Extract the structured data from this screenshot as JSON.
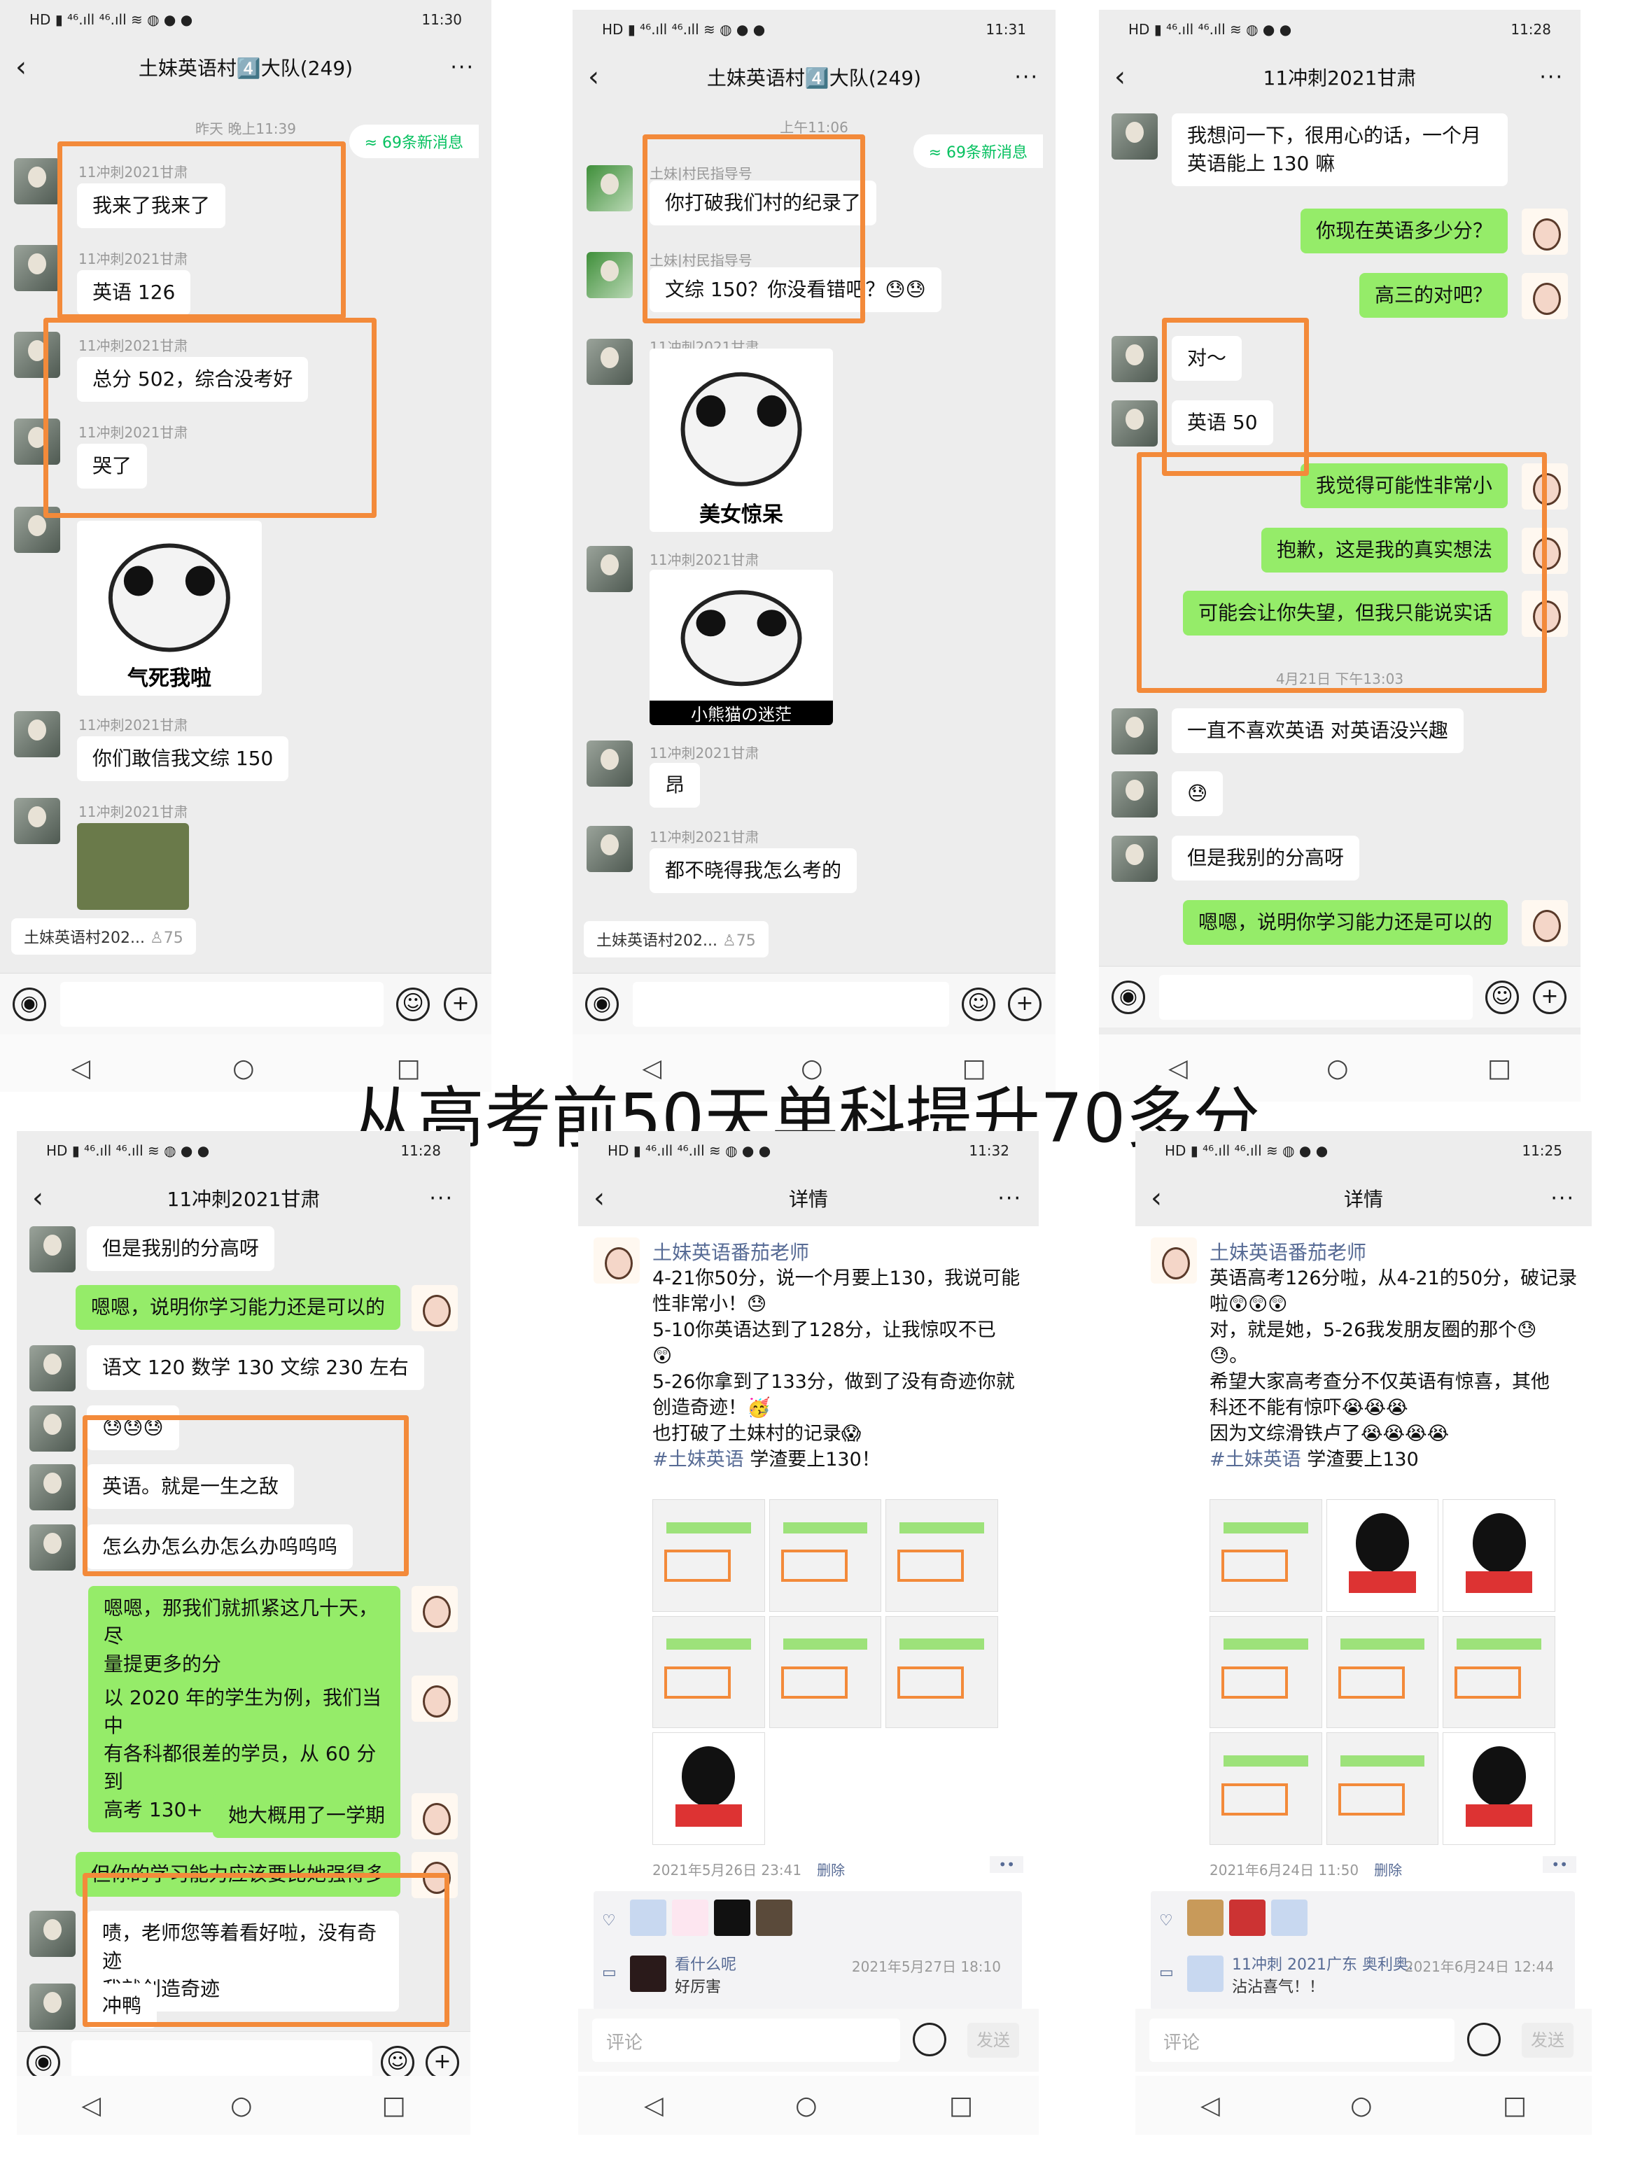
{
  "headline": "从高考前50天单科提升70多分",
  "status": {
    "p1": "11:30",
    "p2": "11:31",
    "p3": "11:28",
    "p4": "11:28",
    "p5": "11:32",
    "p6": "11:25"
  },
  "icons": {
    "back": "‹",
    "more": "···",
    "home": "○",
    "recent": "□",
    "navback": "◁"
  },
  "p1": {
    "title": "土妹英语村4️⃣大队(249)",
    "time": "昨天 晚上11:39",
    "new": "≈ 69条新消息",
    "name": "11冲刺2021甘肃",
    "m1": "我来了我来了",
    "m2": "英语 126",
    "m3": "总分 502，综合没考好",
    "m4": "哭了",
    "s1": "气死我啦",
    "m5": "你们敢信我文综 150",
    "pin": "土妹英语村202...",
    "pin_count": "♙75"
  },
  "p2": {
    "title": "土妹英语村4️⃣大队(249)",
    "time": "上午11:06",
    "new": "≈ 69条新消息",
    "guide": "土妹|村民指导号",
    "g1": "你打破我们村的纪录了",
    "g2": "文综 150？你没看错吧？😓😓",
    "name": "11冲刺2021甘肃",
    "s1": "美女惊呆",
    "s2": "小熊猫の迷茫",
    "m1": "昂",
    "m2": "都不晓得我怎么考的",
    "pin": "土妹英语村202...",
    "pin_count": "♙75"
  },
  "p3": {
    "title": "11冲刺2021甘肃",
    "m1": "我想问一下，很用心的话，一个月\n英语能上 130 嘛",
    "r1": "你现在英语多少分？",
    "r2": "高三的对吧？",
    "m2": "对～",
    "m3": "英语 50",
    "r3": "我觉得可能性非常小",
    "r4": "抱歉，这是我的真实想法",
    "r5": "可能会让你失望，但我只能说实话",
    "time": "4月21日 下午13:03",
    "m4": "一直不喜欢英语 对英语没兴趣",
    "m5": "😓",
    "m6": "但是我别的分高呀",
    "r6": "嗯嗯，说明你学习能力还是可以的"
  },
  "p4": {
    "title": "11冲刺2021甘肃",
    "m1": "但是我别的分高呀",
    "r1": "嗯嗯，说明你学习能力还是可以的",
    "m2": "语文 120 数学 130 文综 230 左右",
    "m3": "😓😓😓",
    "m4": "英语。就是一生之敌",
    "m5": "怎么办怎么办怎么办呜呜呜",
    "r2": "嗯嗯，那我们就抓紧这几十天，尽\n量提更多的分",
    "r3": "以 2020 年的学生为例，我们当中\n有各科都很差的学员，从 60 分到\n高考 130+",
    "r4": "她大概用了一学期",
    "r5": "但你的学习能力应该要比她强得多",
    "m6": "啧，老师您等着看好啦，没有奇迹\n我就创造奇迹",
    "m7": "冲鸭"
  },
  "p5": {
    "title": "详情",
    "author": "土妹英语番茄老师",
    "text": "4-21你50分，说一个月要上130，我说可能\n性非常小！😓\n5-10你英语达到了128分，让我惊叹不已\n😲\n5-26你拿到了133分，做到了没有奇迹你就\n创造奇迹！🥳\n也打破了土妹村的记录😱",
    "tag": "#土妹英语",
    "tail": " 学渣要上130！",
    "date": "2021年5月26日 23:41",
    "del": "删除",
    "c_user": "看什么呢",
    "c_text": "好厉害",
    "c_date": "2021年5月27日 18:10",
    "input": "评论",
    "send": "发送"
  },
  "p6": {
    "title": "详情",
    "author": "土妹英语番茄老师",
    "text": "英语高考126分啦，从4-21的50分，破记录\n啦😲😲😲\n对，就是她，5-26我发朋友圈的那个😓\n😓。\n希望大家高考查分不仅英语有惊喜，其他\n科还不能有惊吓😭😭😭\n因为文综滑铁卢了😭😭😭😭",
    "tag": "#土妹英语",
    "tail": " 学渣要上130",
    "date": "2021年6月24日 11:50",
    "del": "删除",
    "c_user": "11冲刺 2021广东 奥利奥.",
    "c_text": "沾沾喜气！！",
    "c_date": "2021年6月24日 12:44",
    "input": "评论",
    "send": "发送"
  }
}
